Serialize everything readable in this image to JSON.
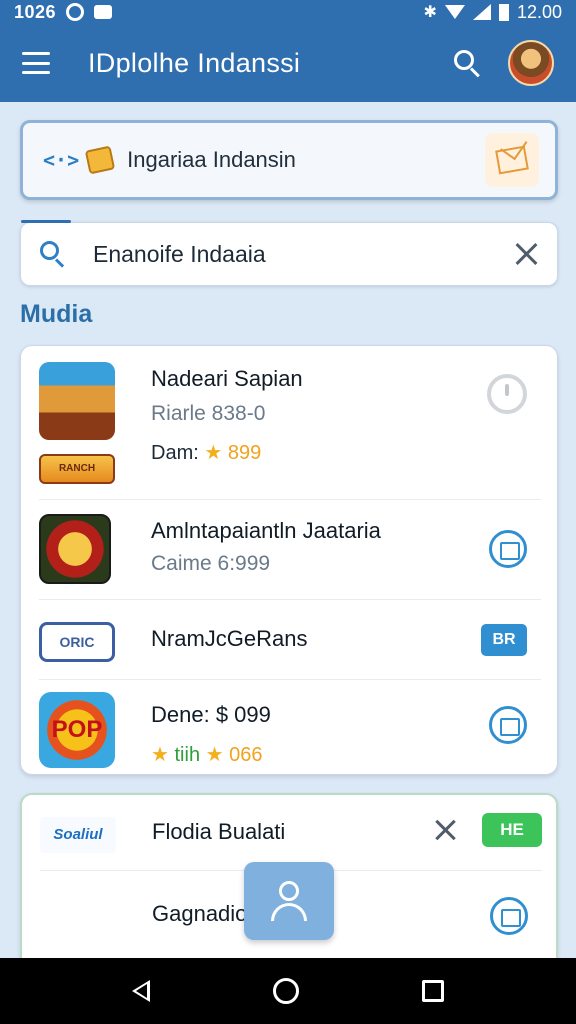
{
  "status_bar": {
    "time": "1026",
    "right_time": "12.00"
  },
  "app_bar": {
    "title": "IDplolhe Indanssi"
  },
  "banner": {
    "text": "Ingariaa Indansin"
  },
  "search": {
    "value": "Enanoife Indaaia"
  },
  "section": {
    "title": "Mudia"
  },
  "list": {
    "items": [
      {
        "primary": "Nadeari Sapian",
        "secondary": "Riarle 838-0",
        "meta_label": "Dam:",
        "meta_value": "899",
        "logo_text": "RANCH"
      },
      {
        "primary": "Amlntapaiantln Jaataria",
        "secondary": "Caime 6:999"
      },
      {
        "primary": "NramJcGeRans",
        "badge": "BR",
        "logo_text": "ORIC"
      },
      {
        "primary": "Dene: $ 099",
        "meta_label": "tiih",
        "meta_value": "066",
        "logo_text": "POP"
      }
    ]
  },
  "card2": {
    "items": [
      {
        "primary": "Flodia Bualati",
        "badge": "HE",
        "logo_text": "Soaliul"
      },
      {
        "primary": "Gagnadionc"
      }
    ]
  },
  "colors": {
    "primary": "#2f6fb0",
    "accent_blue": "#2f8fd0",
    "green": "#3cc45a",
    "star": "#f2b01e"
  },
  "icons": [
    "menu-icon",
    "search-icon",
    "avatar",
    "code-icon",
    "puzzle-icon",
    "envelope-icon",
    "close-icon",
    "star-icon",
    "person-icon",
    "back-icon",
    "home-icon",
    "recents-icon"
  ]
}
